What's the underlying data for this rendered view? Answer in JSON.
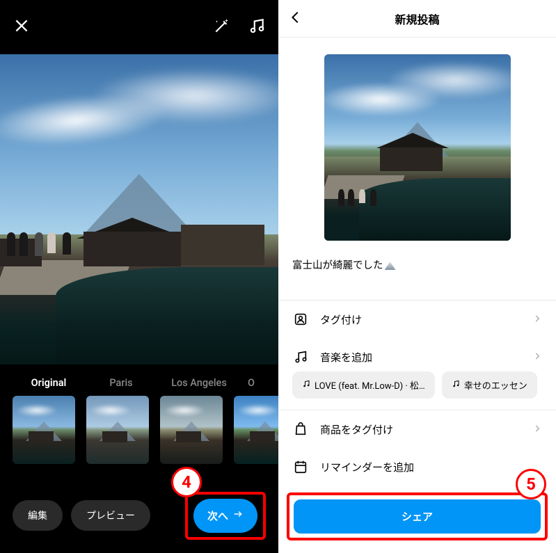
{
  "left": {
    "filters": [
      {
        "label": "Original",
        "active": true
      },
      {
        "label": "Paris",
        "active": false
      },
      {
        "label": "Los Angeles",
        "active": false
      },
      {
        "label": "O",
        "active": false
      }
    ],
    "edit_label": "編集",
    "preview_label": "プレビュー",
    "next_label": "次へ"
  },
  "right": {
    "title": "新規投稿",
    "caption": "富士山が綺麗でした",
    "options": {
      "tag": "タグ付け",
      "music": "音楽を追加",
      "music_chips": [
        "LOVE (feat. Mr.Low-D) · 松…",
        "幸せのエッセン"
      ],
      "products": "商品をタグ付け",
      "reminder": "リマインダーを追加"
    },
    "share_label": "シェア"
  },
  "annotations": {
    "step4": "4",
    "step5": "5"
  }
}
